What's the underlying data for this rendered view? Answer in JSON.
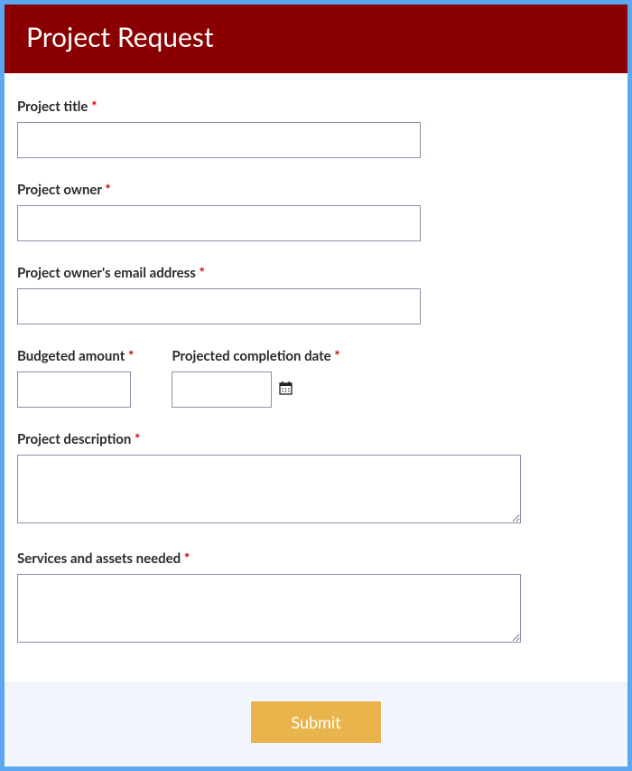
{
  "header": {
    "title": "Project Request"
  },
  "fields": {
    "projectTitle": {
      "label": "Project title",
      "required": "*",
      "value": ""
    },
    "projectOwner": {
      "label": "Project owner",
      "required": "*",
      "value": ""
    },
    "ownerEmail": {
      "label": "Project owner's email address",
      "required": "*",
      "value": ""
    },
    "budget": {
      "label": "Budgeted amount",
      "required": "*",
      "value": ""
    },
    "completionDate": {
      "label": "Projected completion date",
      "required": "*",
      "value": ""
    },
    "description": {
      "label": "Project description",
      "required": "*",
      "value": ""
    },
    "services": {
      "label": "Services and assets needed",
      "required": "*",
      "value": ""
    }
  },
  "footer": {
    "submit": "Submit"
  }
}
